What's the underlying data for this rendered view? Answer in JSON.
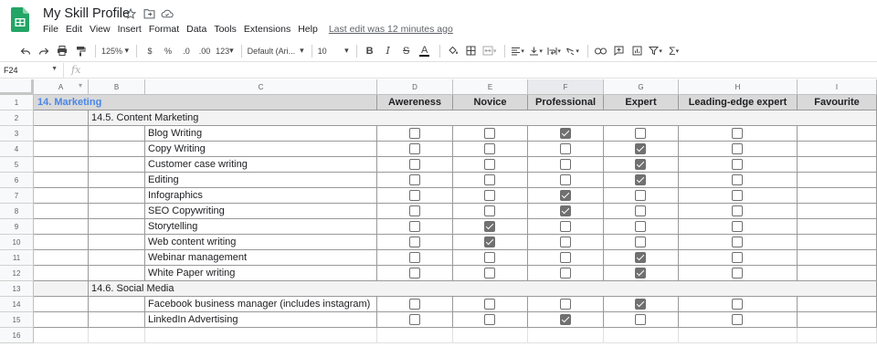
{
  "app": {
    "title": "My Skill Profile",
    "menu": [
      "File",
      "Edit",
      "View",
      "Insert",
      "Format",
      "Data",
      "Tools",
      "Extensions",
      "Help"
    ],
    "last_edit": "Last edit was 12 minutes ago"
  },
  "toolbar": {
    "zoom": "125%",
    "currency": "$",
    "percent": "%",
    "dec_decrease": ".0",
    "dec_increase": ".00",
    "more_formats": "123",
    "font": "Default (Ari...",
    "font_size": "10",
    "bold": "B",
    "italic": "I",
    "strike": "S",
    "text_color": "A"
  },
  "formula_bar": {
    "cell_ref": "F24",
    "fx": "fx"
  },
  "columns": [
    "A",
    "B",
    "C",
    "D",
    "E",
    "F",
    "G",
    "H",
    "I"
  ],
  "selected_column": "F",
  "header_row": {
    "section": "14. Marketing",
    "levels": [
      "Awereness",
      "Novice",
      "Professional",
      "Expert",
      "Leading-edge expert",
      "Favourite"
    ]
  },
  "rows": [
    {
      "num": "1"
    },
    {
      "num": "2",
      "type": "category",
      "label": "14.5. Content Marketing"
    },
    {
      "num": "3",
      "type": "skill",
      "label": "Blog Writing",
      "checks": [
        false,
        false,
        true,
        false,
        false
      ]
    },
    {
      "num": "4",
      "type": "skill",
      "label": "Copy Writing",
      "checks": [
        false,
        false,
        false,
        true,
        false
      ]
    },
    {
      "num": "5",
      "type": "skill",
      "label": "Customer case writing",
      "checks": [
        false,
        false,
        false,
        true,
        false
      ]
    },
    {
      "num": "6",
      "type": "skill",
      "label": "Editing",
      "checks": [
        false,
        false,
        false,
        true,
        false
      ]
    },
    {
      "num": "7",
      "type": "skill",
      "label": "Infographics",
      "checks": [
        false,
        false,
        true,
        false,
        false
      ]
    },
    {
      "num": "8",
      "type": "skill",
      "label": "SEO Copywriting",
      "checks": [
        false,
        false,
        true,
        false,
        false
      ]
    },
    {
      "num": "9",
      "type": "skill",
      "label": "Storytelling",
      "checks": [
        false,
        true,
        false,
        false,
        false
      ]
    },
    {
      "num": "10",
      "type": "skill",
      "label": "Web content writing",
      "checks": [
        false,
        true,
        false,
        false,
        false
      ]
    },
    {
      "num": "11",
      "type": "skill",
      "label": "Webinar management",
      "checks": [
        false,
        false,
        false,
        true,
        false
      ]
    },
    {
      "num": "12",
      "type": "skill",
      "label": "White Paper writing",
      "checks": [
        false,
        false,
        false,
        true,
        false
      ]
    },
    {
      "num": "13",
      "type": "category",
      "label": "14.6. Social Media"
    },
    {
      "num": "14",
      "type": "skill",
      "label": "Facebook business manager (includes instagram)",
      "checks": [
        false,
        false,
        false,
        true,
        false
      ]
    },
    {
      "num": "15",
      "type": "skill",
      "label": "LinkedIn Advertising",
      "checks": [
        false,
        false,
        true,
        false,
        false
      ]
    },
    {
      "num": "16",
      "type": "empty"
    }
  ],
  "colors": {
    "accent_blue": "#4a86e8",
    "header_gray": "#d9d9d9",
    "category_gray": "#f3f3f3",
    "checkbox_gray": "#707070",
    "logo_green": "#23a566"
  }
}
